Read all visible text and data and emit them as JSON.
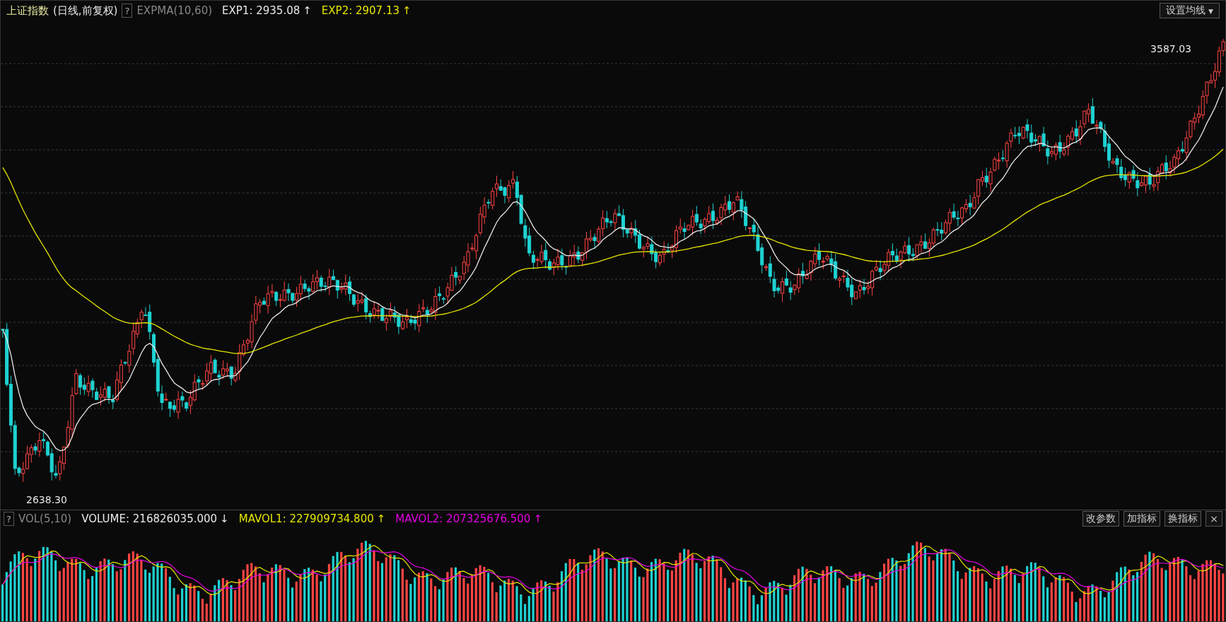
{
  "title": {
    "name": "上证指数",
    "mode": "(日线,前复权)"
  },
  "main_indicator": {
    "help": "?",
    "name": "EXPMA(10,60)",
    "values": [
      {
        "label": "EXP1: 2935.08",
        "arrow": "↑",
        "color": "#e8e8e8"
      },
      {
        "label": "EXP2: 2907.13",
        "arrow": "↑",
        "color": "#e6e600"
      }
    ]
  },
  "ma_button": {
    "label": "设置均线",
    "caret": "▼"
  },
  "price_chart": {
    "high_label": "3587.03",
    "low_label": "2638.30"
  },
  "volume_indicator": {
    "help": "?",
    "name": "VOL(5,10)",
    "values": [
      {
        "label": "VOLUME: 216826035.000",
        "arrow": "↓",
        "color": "#e8e8e8"
      },
      {
        "label": "MAVOL1: 227909734.800",
        "arrow": "↑",
        "color": "#e6e600"
      },
      {
        "label": "MAVOL2: 207325676.500",
        "arrow": "↑",
        "color": "#e600e6"
      }
    ]
  },
  "volume_buttons": [
    "改参数",
    "加指标",
    "换指标"
  ],
  "close": "×"
}
